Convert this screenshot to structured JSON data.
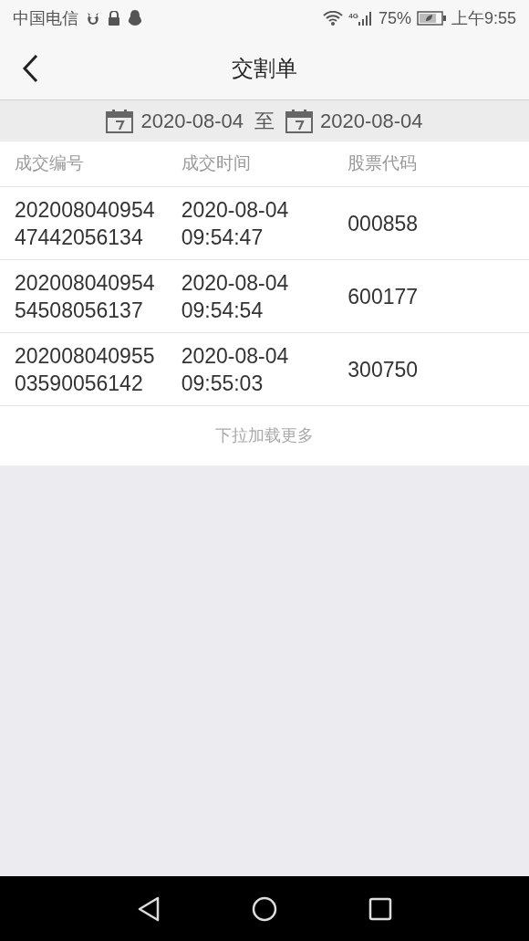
{
  "status_bar": {
    "carrier": "中国电信",
    "network": "4G",
    "battery": "75%",
    "time": "上午9:55"
  },
  "header": {
    "title": "交割单"
  },
  "date_range": {
    "start": "2020-08-04",
    "separator": "至",
    "end": "2020-08-04"
  },
  "table": {
    "columns": [
      "成交编号",
      "成交时间",
      "股票代码"
    ],
    "rows": [
      {
        "id": "202008040954\n47442056134",
        "time": "2020-08-04\n09:54:47",
        "code": "000858"
      },
      {
        "id": "202008040954\n54508056137",
        "time": "2020-08-04\n09:54:54",
        "code": "600177"
      },
      {
        "id": "202008040955\n03590056142",
        "time": "2020-08-04\n09:55:03",
        "code": "300750"
      }
    ]
  },
  "load_more": "下拉加载更多"
}
